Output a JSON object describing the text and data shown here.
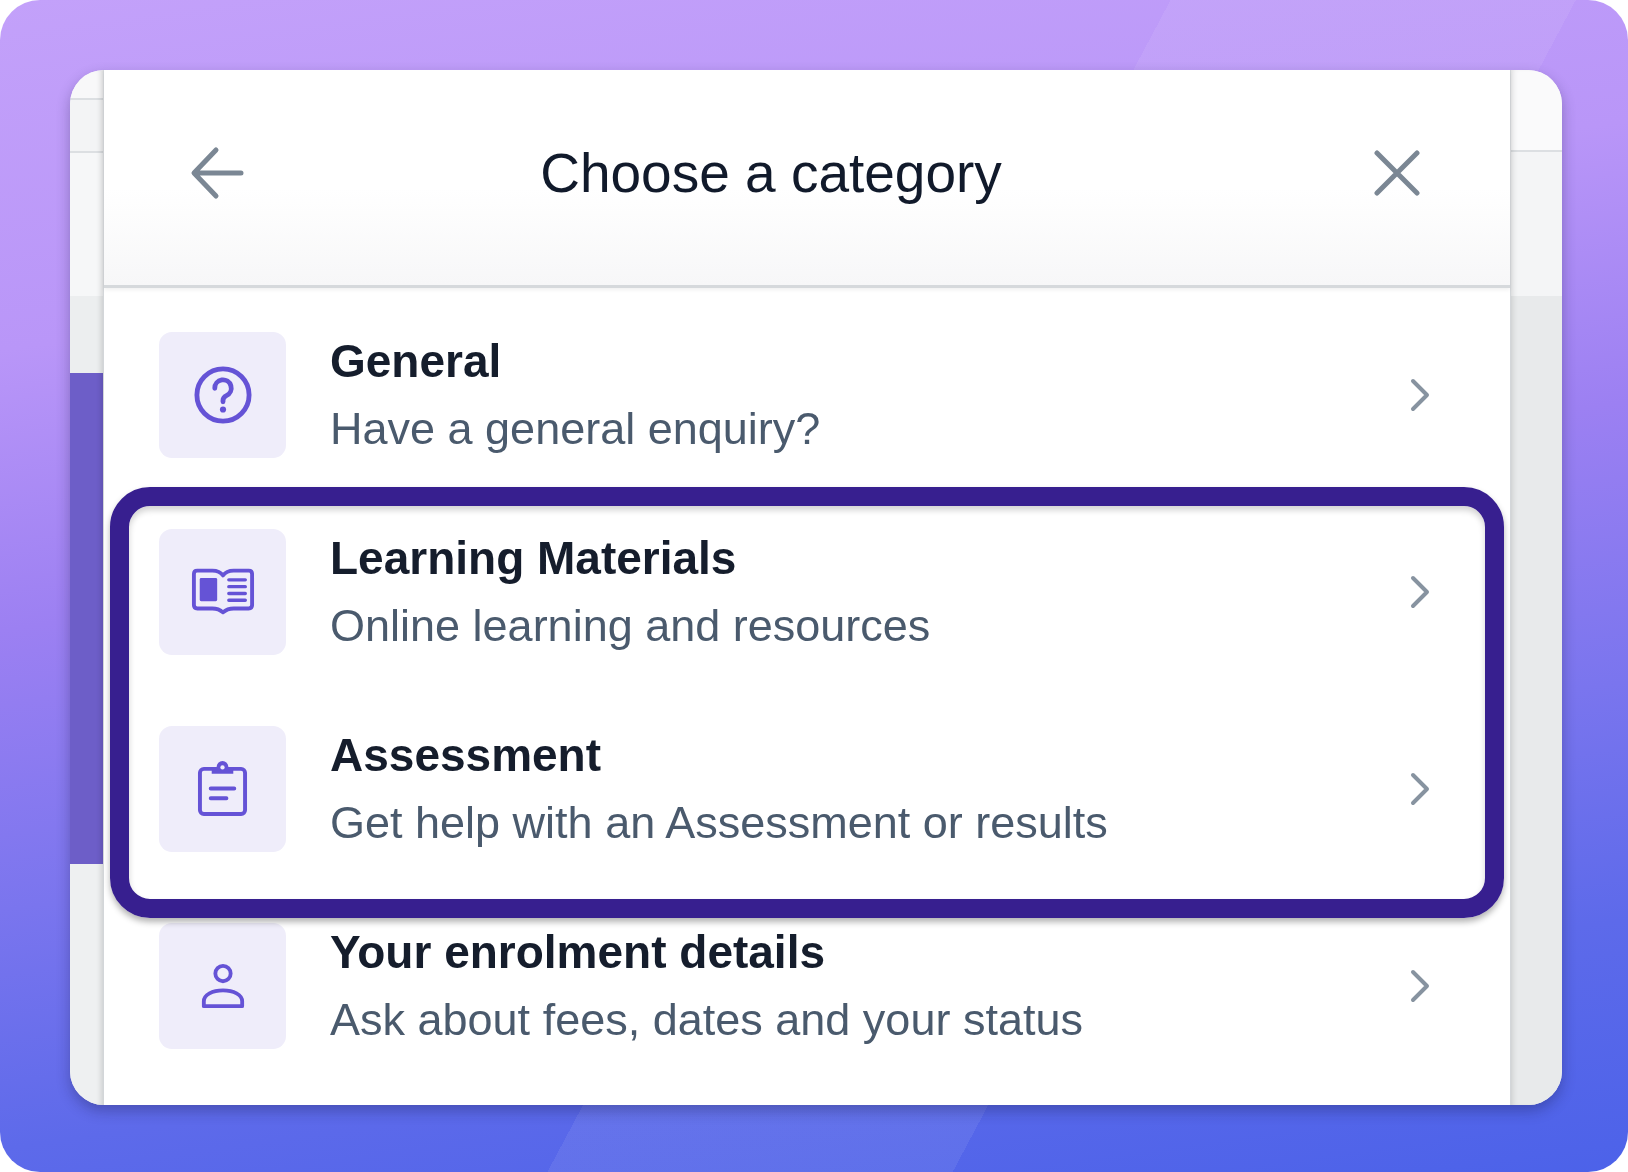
{
  "dialog": {
    "title": "Choose a category"
  },
  "categories": [
    {
      "kind": "general",
      "title": "General",
      "description": "Have a general enquiry?",
      "highlighted": false
    },
    {
      "kind": "materials",
      "title": "Learning Materials",
      "description": "Online learning and resources",
      "highlighted": true
    },
    {
      "kind": "assessment",
      "title": "Assessment",
      "description": "Get help with an Assessment or results",
      "highlighted": true
    },
    {
      "kind": "enrolment",
      "title": "Your enrolment details",
      "description": "Ask about fees, dates and your status",
      "highlighted": false
    }
  ]
}
